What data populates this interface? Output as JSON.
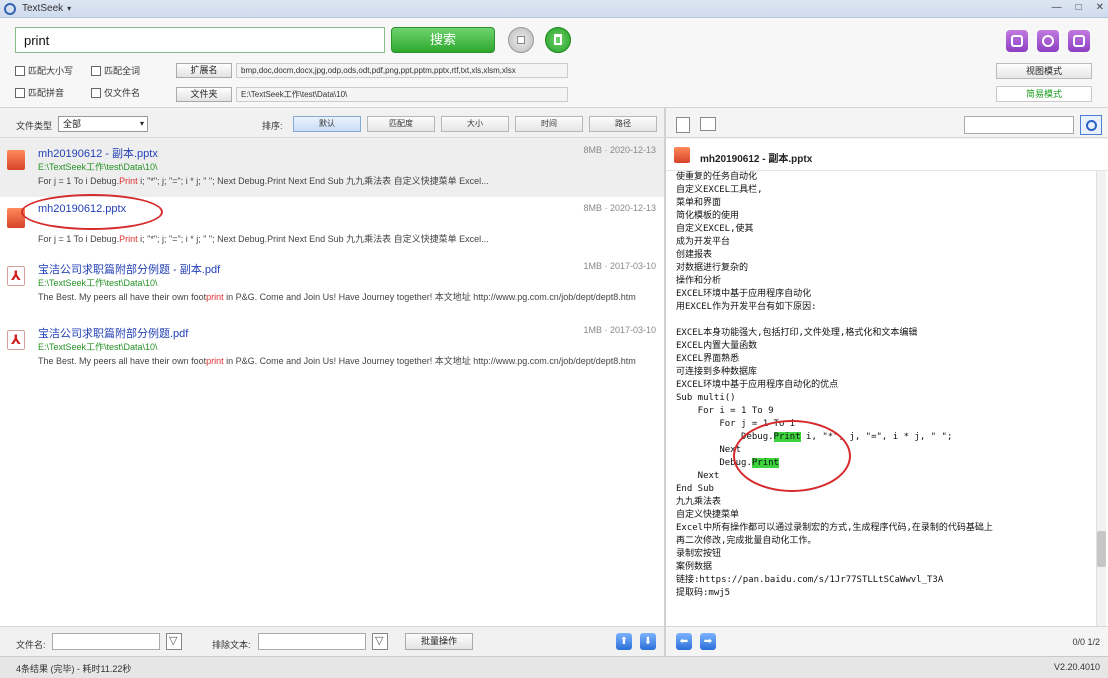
{
  "window": {
    "title": "TextSeek",
    "title_caret": "▾",
    "controls": [
      "—",
      "□",
      "✕"
    ]
  },
  "search": {
    "query": "print",
    "search_label": "搜索"
  },
  "options": {
    "match_case": "匹配大小写",
    "match_whole": "匹配全词",
    "match_pinyin": "匹配拼音",
    "filename_only": "仅文件名"
  },
  "filters": {
    "ext_label": "扩展名",
    "ext_value": "bmp,doc,docm,docx,jpg,odp,ods,odt,pdf,png,ppt,pptm,pptx,rtf,txt,xls,xlsm,xlsx",
    "dir_label": "文件夹",
    "dir_value": "E:\\TextSeek工作\\test\\Data\\10\\"
  },
  "modes": {
    "selection_mode": "视图模式",
    "simple_mode": "简易模式"
  },
  "toolbar": {
    "filetype_label": "文件类型",
    "filetype_value": "全部",
    "sort_label": "排序:",
    "sort_buttons": [
      "默认",
      "匹配度",
      "大小",
      "时间",
      "路径"
    ]
  },
  "results": [
    {
      "name": "mh20190612 - 副本.pptx",
      "path": "E:\\TextSeek工作\\test\\Data\\10\\",
      "size": "8MB",
      "date": "2020-12-13",
      "snippet_pre": "For j = 1 To i Debug.",
      "snippet_mid": "Print",
      "snippet_post": " i; \"*\"; j; \"=\"; i * j; \" \"; Next Debug.Print Next End Sub 九九乘法表 自定义快捷菜单 Excel..."
    },
    {
      "name": "mh20190612.pptx",
      "path": "",
      "size": "8MB",
      "date": "2020-12-13",
      "snippet_pre": "For j = 1 To i Debug.",
      "snippet_mid": "Print",
      "snippet_post": " i; \"*\"; j; \"=\"; i * j; \" \"; Next Debug.Print Next End Sub 九九乘法表 自定义快捷菜单 Excel..."
    },
    {
      "name": "宝洁公司求职篇附部分例题 - 副本.pdf",
      "path": "E:\\TextSeek工作\\test\\Data\\10\\",
      "size": "1MB",
      "date": "2017-03-10",
      "snippet_pre": "The Best. My peers all have their own foot",
      "snippet_mid": "print",
      "snippet_post": " in P&G. Come and Join Us! Have Journey together! 本文地址 http://www.pg.com.cn/job/dept/dept8.htm"
    },
    {
      "name": "宝洁公司求职篇附部分例题.pdf",
      "path": "E:\\TextSeek工作\\test\\Data\\10\\",
      "size": "1MB",
      "date": "2017-03-10",
      "snippet_pre": "The Best. My peers all have their own foot",
      "snippet_mid": "print",
      "snippet_post": " in P&G. Come and Join Us! Have Journey together! 本文地址 http://www.pg.com.cn/job/dept/dept8.htm"
    }
  ],
  "preview": {
    "title": "mh20190612 - 副本.pptx",
    "lines": [
      "使重复的任务自动化",
      "自定义EXCEL工具栏,",
      "菜单和界面",
      "简化模板的使用",
      "自定义EXCEL,使其",
      "成为开发平台",
      "创建报表",
      "对数据进行复杂的",
      "操作和分析",
      "EXCEL环境中基于应用程序自动化",
      "用EXCEL作为开发平台有如下原因:",
      "",
      "EXCEL本身功能强大,包括打印,文件处理,格式化和文本编辑",
      "EXCEL内置大量函数",
      "EXCEL界面熟悉",
      "可连接到多种数据库",
      "EXCEL环境中基于应用程序自动化的优点",
      "Sub multi()",
      "    For i = 1 To 9",
      "        For j = 1 To i",
      "            Debug.",
      "        Next",
      "        Debug.",
      "    Next",
      "End Sub",
      "九九乘法表",
      "自定义快捷菜单",
      "Excel中所有操作都可以通过录制宏的方式,生成程序代码,在录制的代码基础上",
      "再二次修改,完成批量自动化工作。",
      "录制宏按钮",
      "案例数据",
      "链接:https://pan.baidu.com/s/1Jr77STLLtSCaWwvl_T3A",
      "提取码:mwj5"
    ],
    "highlight": "Print",
    "line20_tail": " i, \"*\", j, \"=\", i * j, \" \";"
  },
  "bottom": {
    "filename_label": "文件名:",
    "exclude_label": "排除文本:",
    "batch_label": "批量操作",
    "page_indicator": "0/0  1/2"
  },
  "status": {
    "left": "4条结果   (完毕) - 耗时11.22秒",
    "right": "V2.20.4010"
  },
  "colors": {
    "accent_green": "#2ea82e",
    "link_blue": "#2340b8",
    "path_green": "#239123",
    "highlight_red": "#e03030",
    "annotation_red": "#d62b2b"
  }
}
